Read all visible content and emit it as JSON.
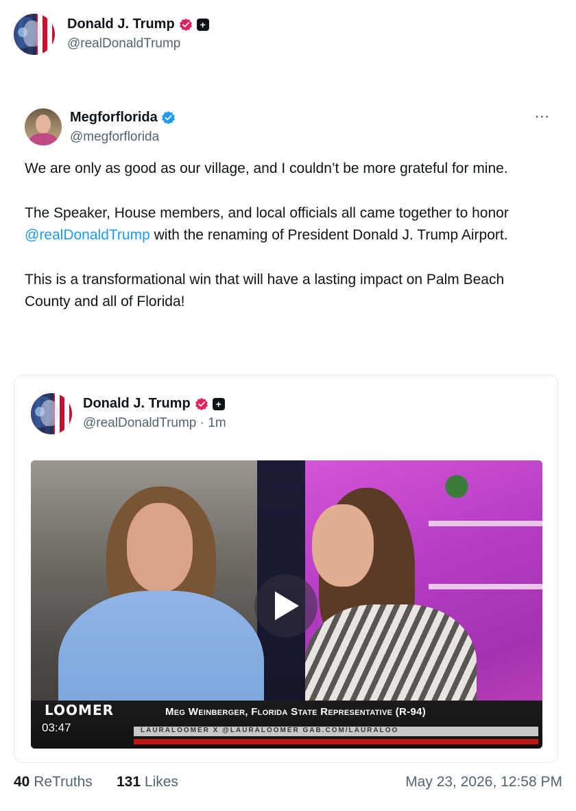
{
  "top_author": {
    "name": "Donald J. Trump",
    "handle": "@realDonaldTrump",
    "avatar_icon": "flag-portrait-avatar",
    "badges": [
      "verified-pink-icon",
      "plus-badge-icon"
    ]
  },
  "post": {
    "author": {
      "name": "Megforflorida",
      "handle": "@megforflorida",
      "badge": "verified-blue-icon"
    },
    "more_icon": "⋯",
    "paragraph1": "We are only as good as our village, and I couldn’t be more grateful for mine.",
    "paragraph2_pre": "The Speaker, House members, and local officials all came together to honor ",
    "paragraph2_mention": "@realDonaldTrump",
    "paragraph2_post": " with the renaming of President Donald J. Trump Airport.",
    "paragraph3": "This is a transformational win that will have a lasting impact on Palm Beach County and all of Florida!"
  },
  "embedded": {
    "author": {
      "name": "Donald J. Trump",
      "handle": "@realDonaldTrump · 1m"
    },
    "video": {
      "duration": "03:47",
      "overlay_logo": "LOOMER",
      "overlay_caption": "Meg Weinberger, Florida State Representative (R-94)",
      "ticker_text": "LAURALOOMER   X @LAURALOOMER   GAB.COM/LAURALOO"
    }
  },
  "footer": {
    "retruths_count": "40",
    "retruths_label": "ReTruths",
    "likes_count": "131",
    "likes_label": "Likes",
    "timestamp": "May 23, 2026, 12:58 PM"
  },
  "colors": {
    "mention": "#1d9bf0",
    "verified_blue": "#1d9bf0",
    "verified_pink": "#e0245e",
    "secondary_text": "#536471"
  }
}
